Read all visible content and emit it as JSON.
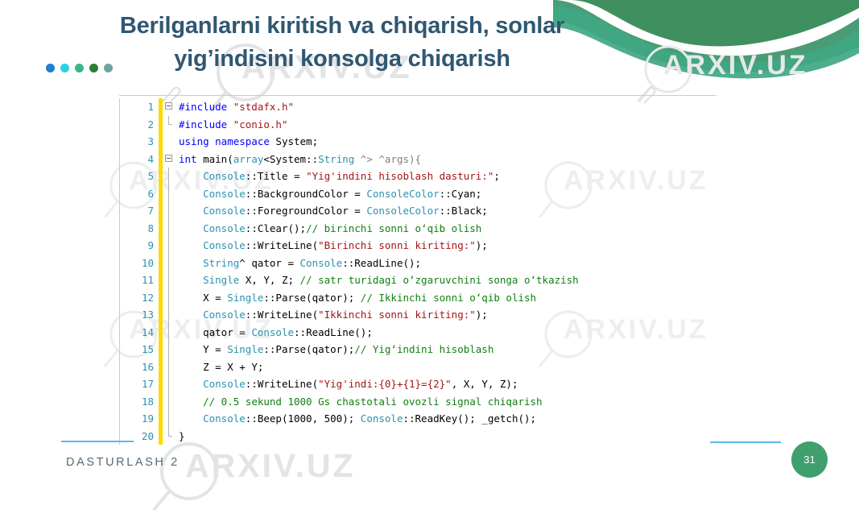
{
  "slide": {
    "title_line1": "Berilganlarni kiritish va chiqarish, sonlar",
    "title_line2": "yig’indisini konsolga chiqarish",
    "title_color": "#2f5771",
    "footer_label": "DASTURLASH 2",
    "page_number": "31",
    "accent_line_color": "#5bb8e8",
    "badge_color": "#3fa06e"
  },
  "decor": {
    "wave_dark": "#3f8f5f",
    "wave_light": "#40a783",
    "wave_mid": "#55a87f",
    "dots": [
      {
        "name": "dot-blue",
        "color": "#1f7fd0"
      },
      {
        "name": "dot-cyan",
        "color": "#2ad2e0"
      },
      {
        "name": "dot-teal",
        "color": "#3bb58b"
      },
      {
        "name": "dot-green",
        "color": "#2a7f35"
      },
      {
        "name": "dot-gray",
        "color": "#6fa3a3"
      }
    ],
    "watermark_text": "ARXIV.UZ"
  },
  "code": {
    "lines": [
      {
        "n": "1",
        "fold": "start",
        "tokens": [
          {
            "t": "#include ",
            "c": "pp"
          },
          {
            "t": "\"stdafx.h\"",
            "c": "str"
          }
        ]
      },
      {
        "n": "2",
        "fold": "end",
        "tokens": [
          {
            "t": "#include ",
            "c": "pp"
          },
          {
            "t": "\"conio.h\"",
            "c": "str"
          }
        ]
      },
      {
        "n": "3",
        "fold": "none",
        "tokens": [
          {
            "t": "using namespace ",
            "c": "kw"
          },
          {
            "t": "System;",
            "c": "pln"
          }
        ]
      },
      {
        "n": "4",
        "fold": "start",
        "tokens": [
          {
            "t": "int ",
            "c": "kw"
          },
          {
            "t": "main(",
            "c": "pln"
          },
          {
            "t": "array",
            "c": "type"
          },
          {
            "t": "<System::",
            "c": "pln"
          },
          {
            "t": "String",
            "c": "type"
          },
          {
            "t": " ^> ",
            "c": "gray"
          },
          {
            "t": "^args){",
            "c": "gray"
          }
        ]
      },
      {
        "n": "5",
        "fold": "bar",
        "indent": 4,
        "tokens": [
          {
            "t": "Console",
            "c": "type"
          },
          {
            "t": "::Title = ",
            "c": "pln"
          },
          {
            "t": "\"Yig'indini hisoblash dasturi:\"",
            "c": "str"
          },
          {
            "t": ";",
            "c": "pln"
          }
        ]
      },
      {
        "n": "6",
        "fold": "bar",
        "indent": 4,
        "tokens": [
          {
            "t": "Console",
            "c": "type"
          },
          {
            "t": "::BackgroundColor = ",
            "c": "pln"
          },
          {
            "t": "ConsoleColor",
            "c": "type"
          },
          {
            "t": "::Cyan;",
            "c": "pln"
          }
        ]
      },
      {
        "n": "7",
        "fold": "bar",
        "indent": 4,
        "tokens": [
          {
            "t": "Console",
            "c": "type"
          },
          {
            "t": "::ForegroundColor = ",
            "c": "pln"
          },
          {
            "t": "ConsoleColor",
            "c": "type"
          },
          {
            "t": "::Black;",
            "c": "pln"
          }
        ]
      },
      {
        "n": "8",
        "fold": "bar",
        "indent": 4,
        "tokens": [
          {
            "t": "Console",
            "c": "type"
          },
          {
            "t": "::Clear();",
            "c": "pln"
          },
          {
            "t": "// birinchi sonni oʻqib olish",
            "c": "cmt"
          }
        ]
      },
      {
        "n": "9",
        "fold": "bar",
        "indent": 4,
        "tokens": [
          {
            "t": "Console",
            "c": "type"
          },
          {
            "t": "::WriteLine(",
            "c": "pln"
          },
          {
            "t": "\"Birinchi sonni kiriting:\"",
            "c": "str"
          },
          {
            "t": ");",
            "c": "pln"
          }
        ]
      },
      {
        "n": "10",
        "fold": "bar",
        "indent": 4,
        "tokens": [
          {
            "t": "String",
            "c": "type"
          },
          {
            "t": "^ qator = ",
            "c": "pln"
          },
          {
            "t": "Console",
            "c": "type"
          },
          {
            "t": "::ReadLine();",
            "c": "pln"
          }
        ]
      },
      {
        "n": "11",
        "fold": "bar",
        "indent": 4,
        "tokens": [
          {
            "t": "Single",
            "c": "type"
          },
          {
            "t": " X, Y, Z; ",
            "c": "pln"
          },
          {
            "t": "// satr turidagi oʻzgaruvchini songa oʻtkazish",
            "c": "cmt"
          }
        ]
      },
      {
        "n": "12",
        "fold": "bar",
        "indent": 4,
        "tokens": [
          {
            "t": "X = ",
            "c": "pln"
          },
          {
            "t": "Single",
            "c": "type"
          },
          {
            "t": "::Parse(qator); ",
            "c": "pln"
          },
          {
            "t": "// Ikkinchi sonni oʻqib olish",
            "c": "cmt"
          }
        ]
      },
      {
        "n": "13",
        "fold": "bar",
        "indent": 4,
        "tokens": [
          {
            "t": "Console",
            "c": "type"
          },
          {
            "t": "::WriteLine(",
            "c": "pln"
          },
          {
            "t": "\"Ikkinchi sonni kiriting:\"",
            "c": "str"
          },
          {
            "t": ");",
            "c": "pln"
          }
        ]
      },
      {
        "n": "14",
        "fold": "bar",
        "indent": 4,
        "tokens": [
          {
            "t": "qator = ",
            "c": "pln"
          },
          {
            "t": "Console",
            "c": "type"
          },
          {
            "t": "::ReadLine();",
            "c": "pln"
          }
        ]
      },
      {
        "n": "15",
        "fold": "bar",
        "indent": 4,
        "tokens": [
          {
            "t": "Y = ",
            "c": "pln"
          },
          {
            "t": "Single",
            "c": "type"
          },
          {
            "t": "::Parse(qator);",
            "c": "pln"
          },
          {
            "t": "// Yigʻindini hisoblash",
            "c": "cmt"
          }
        ]
      },
      {
        "n": "16",
        "fold": "bar",
        "indent": 4,
        "tokens": [
          {
            "t": "Z = X + Y;",
            "c": "pln"
          }
        ]
      },
      {
        "n": "17",
        "fold": "bar",
        "indent": 4,
        "tokens": [
          {
            "t": "Console",
            "c": "type"
          },
          {
            "t": "::WriteLine(",
            "c": "pln"
          },
          {
            "t": "\"Yig'indi:{0}+{1}={2}\"",
            "c": "str"
          },
          {
            "t": ", X, Y, Z);",
            "c": "pln"
          }
        ]
      },
      {
        "n": "18",
        "fold": "bar",
        "indent": 4,
        "tokens": [
          {
            "t": "// 0.5 sekund 1000 Gs chastotali ovozli signal chiqarish",
            "c": "cmt"
          }
        ]
      },
      {
        "n": "19",
        "fold": "bar",
        "indent": 4,
        "tokens": [
          {
            "t": "Console",
            "c": "type"
          },
          {
            "t": "::Beep(1000, 500); ",
            "c": "pln"
          },
          {
            "t": "Console",
            "c": "type"
          },
          {
            "t": "::ReadKey(); ",
            "c": "pln"
          },
          {
            "t": "_getch();",
            "c": "pln"
          }
        ]
      },
      {
        "n": "20",
        "fold": "close",
        "tokens": [
          {
            "t": "}",
            "c": "pln"
          }
        ]
      }
    ]
  }
}
